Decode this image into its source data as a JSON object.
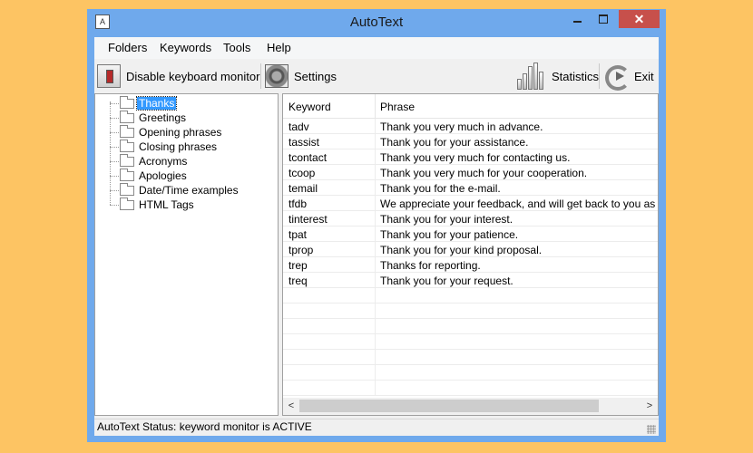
{
  "window": {
    "title": "AutoText",
    "icon": "app-icon-letter-a",
    "close_glyph": "✕"
  },
  "menu": [
    "Folders",
    "Keywords",
    "Tools",
    "Help"
  ],
  "toolbar": {
    "disable_label": "Disable keyboard monitor",
    "settings_label": "Settings",
    "statistics_label": "Statistics",
    "exit_label": "Exit"
  },
  "folders": [
    "Thanks",
    "Greetings",
    "Opening phrases",
    "Closing phrases",
    "Acronyms",
    "Apologies",
    "Date/Time examples",
    "HTML Tags"
  ],
  "selected_folder": "Thanks",
  "table": {
    "columns": [
      "Keyword",
      "Phrase"
    ],
    "rows": [
      {
        "keyword": "tadv",
        "phrase": "Thank you very much in advance."
      },
      {
        "keyword": "tassist",
        "phrase": "Thank you for your assistance."
      },
      {
        "keyword": "tcontact",
        "phrase": "Thank you very much for contacting us."
      },
      {
        "keyword": "tcoop",
        "phrase": "Thank you very much for your cooperation."
      },
      {
        "keyword": "temail",
        "phrase": "Thank you for the e-mail."
      },
      {
        "keyword": "tfdb",
        "phrase": "We appreciate your feedback, and will get back to you as soon a"
      },
      {
        "keyword": "tinterest",
        "phrase": "Thank you for your interest."
      },
      {
        "keyword": "tpat",
        "phrase": "Thank you for your patience."
      },
      {
        "keyword": "tprop",
        "phrase": "Thank you for your kind proposal."
      },
      {
        "keyword": "trep",
        "phrase": "Thanks for reporting."
      },
      {
        "keyword": "treq",
        "phrase": "Thank you for your request."
      }
    ]
  },
  "status": {
    "text": "AutoText Status: keyword monitor is ACTIVE"
  },
  "scroll": {
    "left_glyph": "<",
    "right_glyph": ">"
  },
  "colors": {
    "background": "#fdc463",
    "titlebar": "#6fa9ec",
    "close": "#c7504b",
    "selection": "#3399ff"
  }
}
